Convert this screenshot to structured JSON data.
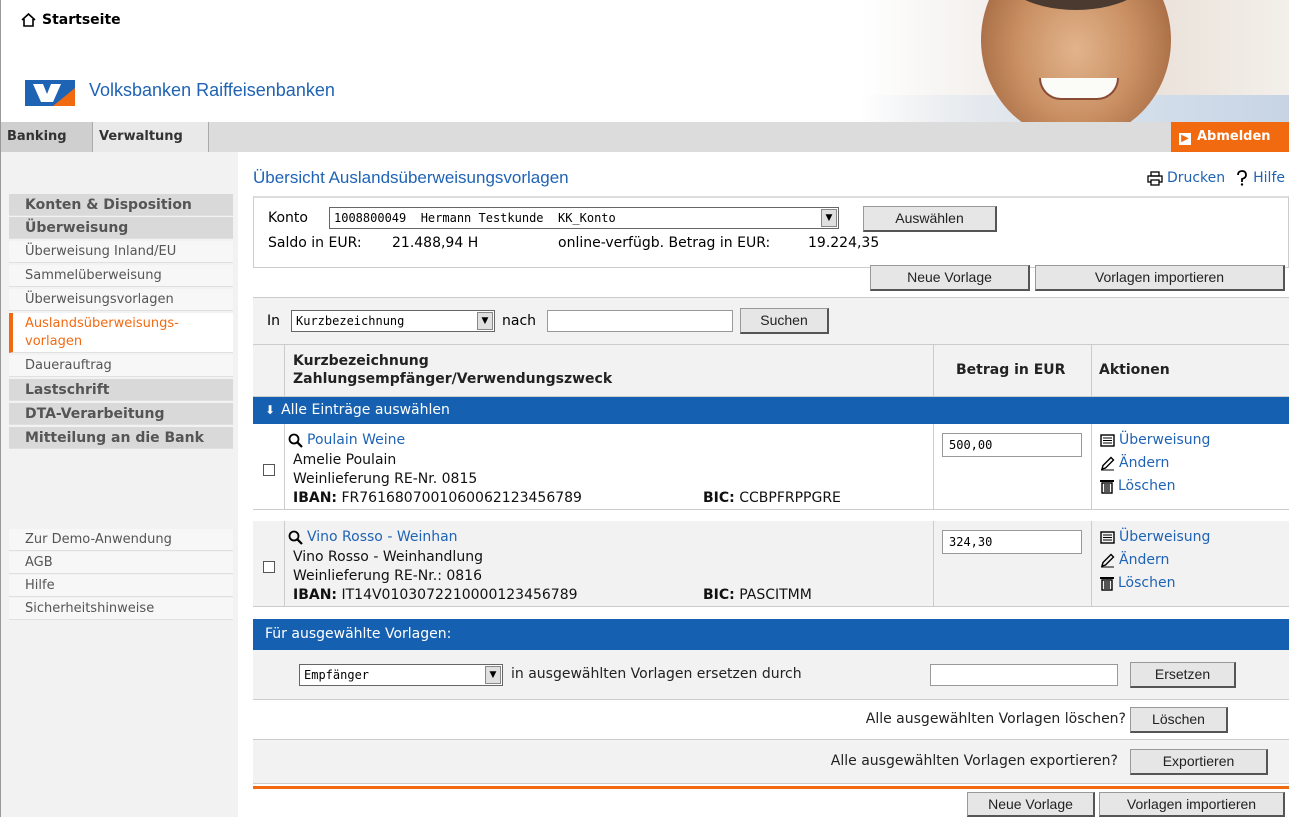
{
  "header": {
    "home_label": "Startseite",
    "bank_name": "Volksbanken Raiffeisenbanken"
  },
  "tabs": [
    {
      "label": "Banking",
      "active": true
    },
    {
      "label": "Verwaltung",
      "active": false
    }
  ],
  "logout_label": "Abmelden",
  "sidebar": {
    "items": [
      {
        "label": "Konten & Disposition",
        "kind": "head"
      },
      {
        "label": "Überweisung",
        "kind": "head"
      },
      {
        "label": "Überweisung Inland/EU",
        "kind": "sub"
      },
      {
        "label": "Sammelüberweisung",
        "kind": "sub"
      },
      {
        "label": "Überweisungsvorlagen",
        "kind": "sub"
      },
      {
        "label": "Auslandsüberweisungs-",
        "label2": "vorlagen",
        "kind": "active"
      },
      {
        "label": "Dauerauftrag",
        "kind": "sub"
      },
      {
        "label": "Lastschrift",
        "kind": "head"
      },
      {
        "label": "DTA-Verarbeitung",
        "kind": "head"
      },
      {
        "label": "Mitteilung an die Bank",
        "kind": "head"
      }
    ],
    "footer_items": [
      "Zur Demo-Anwendung",
      "AGB",
      "Hilfe",
      "Sicherheitshinweise"
    ]
  },
  "page": {
    "title": "Übersicht Auslandsüberweisungsvorlagen",
    "print_label": "Drucken",
    "help_label": "Hilfe"
  },
  "konto": {
    "label": "Konto",
    "selected": "1008800049  Hermann Testkunde  KK_Konto",
    "select_button": "Auswählen",
    "saldo_label": "Saldo in EUR:",
    "saldo_value": "21.488,94 H",
    "available_label": "online-verfügb. Betrag in EUR:",
    "available_value": "19.224,35"
  },
  "actions_top": {
    "new_template": "Neue Vorlage",
    "import_templates": "Vorlagen importieren"
  },
  "search": {
    "in_label": "In",
    "field_selected": "Kurzbezeichnung",
    "nach_label": "nach",
    "query": "",
    "button": "Suchen"
  },
  "table": {
    "col_name_line1": "Kurzbezeichnung",
    "col_name_line2": "Zahlungsempfänger/Verwendungszweck",
    "col_amount": "Betrag in EUR",
    "col_actions": "Aktionen",
    "select_all": "Alle Einträge auswählen",
    "iban_label": "IBAN:",
    "bic_label": "BIC:",
    "action_transfer": "Überweisung",
    "action_edit": "Ändern",
    "action_delete": "Löschen",
    "rows": [
      {
        "short_name": "Poulain Weine",
        "recipient": "Amelie Poulain",
        "purpose": "Weinlieferung RE-Nr. 0815",
        "iban": "FR7616807001060062123456789",
        "bic": "CCBPFRPPGRE",
        "amount": "500,00"
      },
      {
        "short_name": "Vino Rosso - Weinhan",
        "recipient": "Vino Rosso - Weinhandlung",
        "purpose": "Weinlieferung RE-Nr.: 0816",
        "iban": "IT14V0103072210000123456789",
        "bic": "PASCITMM",
        "amount": "324,30"
      }
    ]
  },
  "bulk": {
    "header": "Für ausgewählte Vorlagen:",
    "replace_field": "Empfänger",
    "replace_text": "in ausgewählten Vorlagen ersetzen durch",
    "replace_value": "",
    "replace_button": "Ersetzen",
    "delete_text": "Alle ausgewählten Vorlagen löschen?",
    "delete_button": "Löschen",
    "export_text": "Alle ausgewählten Vorlagen exportieren?",
    "export_button": "Exportieren"
  },
  "actions_bottom": {
    "new_template": "Neue Vorlage",
    "import_templates": "Vorlagen importieren"
  },
  "colors": {
    "brand_blue": "#1f63b5",
    "bar_blue": "#1560b0",
    "accent_orange": "#f26a10"
  }
}
